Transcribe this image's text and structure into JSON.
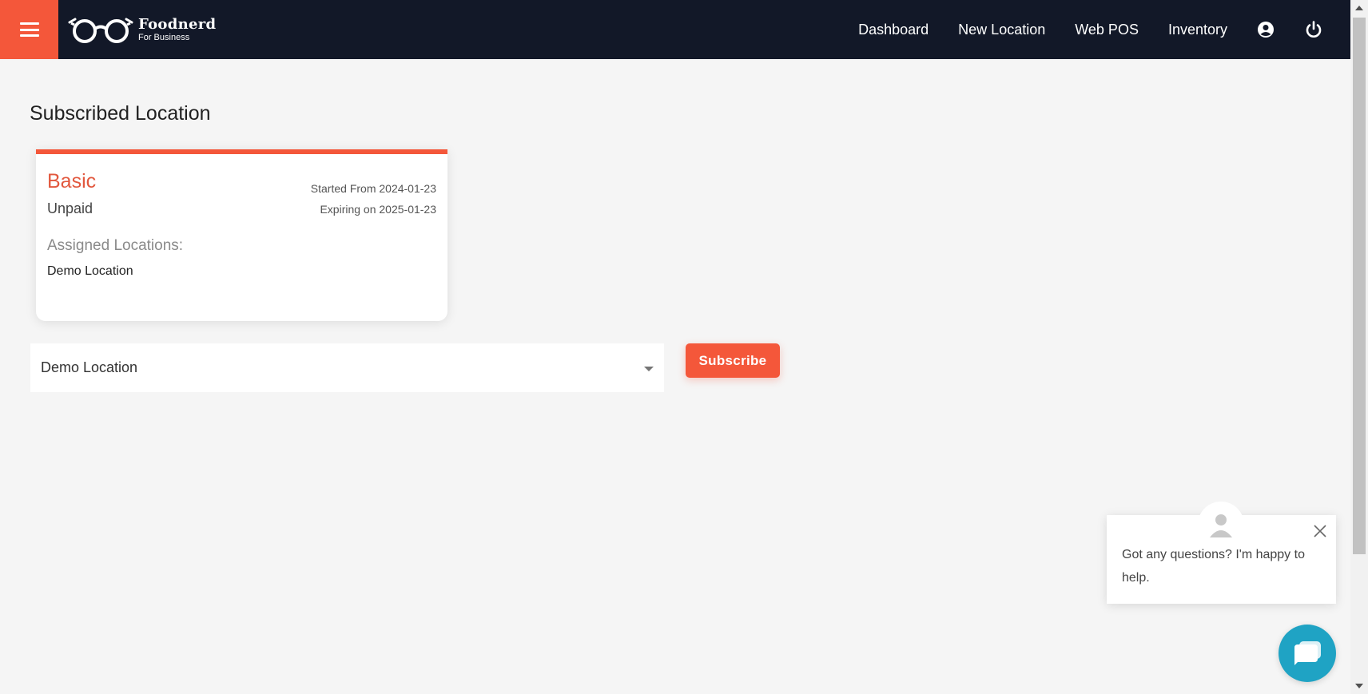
{
  "header": {
    "brand_name": "Foodnerd",
    "brand_sub": "For Business",
    "nav": [
      {
        "label": "Dashboard"
      },
      {
        "label": "New Location"
      },
      {
        "label": "Web POS"
      },
      {
        "label": "Inventory"
      }
    ],
    "icons": [
      "menu-icon",
      "glasses-logo",
      "account-icon",
      "power-icon"
    ],
    "accent_color": "#f4573a",
    "bar_color": "#121828"
  },
  "main": {
    "title": "Subscribed Location",
    "plan_card": {
      "plan": "Basic",
      "status": "Unpaid",
      "started": "Started From 2024-01-23",
      "expiring": "Expiring on 2025-01-23",
      "assigned_label": "Assigned Locations:",
      "assigned": [
        "Demo Location"
      ]
    },
    "location_select": {
      "value": "Demo Location"
    },
    "subscribe_label": "Subscribe"
  },
  "chat": {
    "message": "Got any questions? I'm happy to help.",
    "launcher_color": "#1fa3c4"
  }
}
